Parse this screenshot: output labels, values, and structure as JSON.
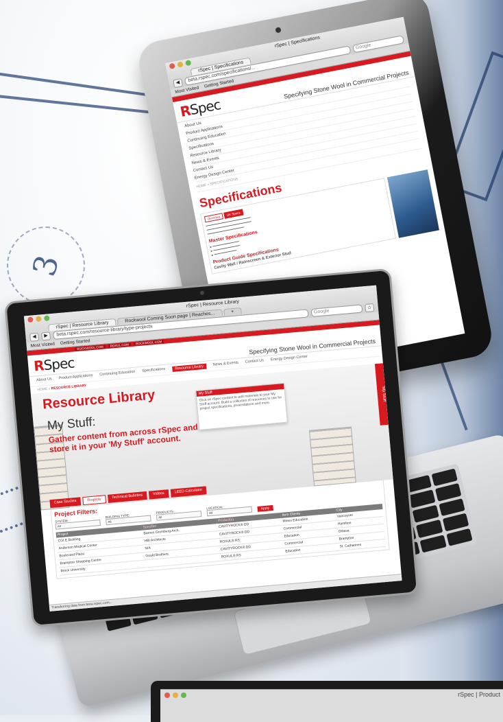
{
  "tablet": {
    "window_title": "rSpec | Specifications",
    "tab_label": "rSpec | Specifications",
    "url": "beta.rspec.com/specifications/...",
    "search_placeholder": "Google",
    "bookmarks": [
      "Most Visited",
      "Getting Started"
    ],
    "logo": "RSpec",
    "tagline": "Specifying Stone Wool in Commercial Projects",
    "nav": [
      "About Us",
      "Product Applications",
      "Continuing Education",
      "Specifications",
      "Resource Library",
      "News & Events",
      "Contact Us",
      "Energy Design Center"
    ],
    "breadcrumb": "HOME » SPECIFICATIONS",
    "page_title": "Specifications",
    "tabs": [
      "Overview",
      "UK Specs"
    ],
    "sections": [
      "Master Specifications",
      "Product Guide Specifications",
      "Cavity Wall / Rainscreen & Exterior Stud"
    ]
  },
  "laptop": {
    "window_title": "rSpec | Resource Library",
    "tabs": [
      {
        "label": "rSpec | Resource Library"
      },
      {
        "label": "Rockwool Coming Soon page | Reaches..."
      }
    ],
    "url": "beta.rspec.com/resource-library/type-projects",
    "search_placeholder": "Google",
    "bookmarks": [
      "Most Visited",
      "Getting Started"
    ],
    "redbar_links": [
      "ROCKWOOL.COM",
      "ROXUL.COM",
      "ROCKWOOL.COM"
    ],
    "logo_r": "R",
    "logo_rest": "Spec",
    "tagline": "Specifying Stone Wool in Commercial Projects",
    "main_nav": [
      "About Us",
      "Product Applications",
      "Continuing Education",
      "Specifications",
      "Resource Library",
      "News & Events",
      "Contact Us",
      "Energy Design Center"
    ],
    "active_nav_index": 4,
    "breadcrumb_home": "HOME »",
    "breadcrumb_current": "RESOURCE LIBRARY",
    "page_title": "Resource Library",
    "mystuff_heading": "My Stuff:",
    "mystuff_promo": "Gather content from across rSpec and store it in your 'My Stuff' account.",
    "mystuff_box_title": "My Stuff",
    "mystuff_box_text": "Click on rSpec content to add materials to your My Stuff account. Build a collection of resources to use for project specifications, presentations and more.",
    "side_tab": "My Stuff",
    "content_tabs": [
      "Case Studies",
      "Projects",
      "Technical Bulletins",
      "Videos",
      "LEED Calculator"
    ],
    "active_content_tab": 1,
    "filters_title": "Project Filters:",
    "filters": [
      {
        "label": "SYSTEM:",
        "value": "All"
      },
      {
        "label": "BUILDING TYPE:",
        "value": "All"
      },
      {
        "label": "PRODUCTS:",
        "value": "All"
      },
      {
        "label": "LOCATION:",
        "value": "All"
      }
    ],
    "apply_label": "Apply",
    "table_headers": [
      "Project",
      "Specifier",
      "Product(s)",
      "Item Clients",
      "City"
    ],
    "table_rows": [
      [
        "CGI E Building",
        "Barnes Gromberg Arch.",
        "CAVITYROCK® DD",
        "Mines Education",
        "Vancouver"
      ],
      [
        "Anderson Medical Center",
        "HBI Architects",
        "CAVITYROCK® DD",
        "Commercial",
        "Hamilton"
      ],
      [
        "Boulevard Plaza",
        "N/A",
        "ROXUL® RS",
        "Education",
        "Ottawa"
      ],
      [
        "Brampton Shopping Centre",
        "Gould Brothers",
        "CAVITYROCK® DD",
        "Commercial",
        "Brampton"
      ],
      [
        "Brock University",
        "",
        "ROXUL® RS",
        "Education",
        "St. Catharines"
      ]
    ],
    "status_text": "Transferring data from beta.rspec.com..."
  },
  "monitor": {
    "window_title": "rSpec | Product"
  },
  "colors": {
    "brand_red": "#d71920",
    "blueprint": "#2f4a7a"
  }
}
